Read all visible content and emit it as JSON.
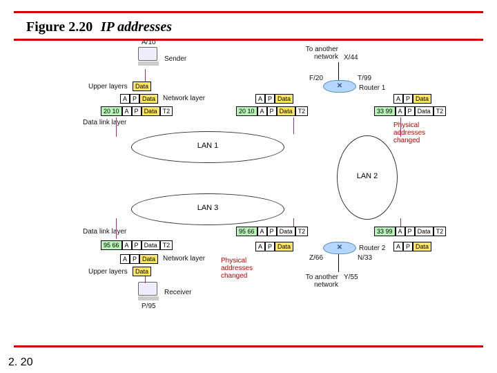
{
  "title": {
    "figure": "Figure 2.20",
    "subtitle": "IP addresses"
  },
  "footer": "2. 20",
  "nodes": {
    "sender_pc": "A/10",
    "receiver_pc": "P/95",
    "router1_left": "F/20",
    "router1_right": "T/99",
    "router2_left": "Z/66",
    "router2_right": "N/33",
    "external_top": "X/44",
    "external_bottom": "Y/55"
  },
  "labels": {
    "sender": "Sender",
    "receiver": "Receiver",
    "upper": "Upper layers",
    "network": "Network layer",
    "datalink": "Data link layer",
    "to_another": "To another\nnetwork",
    "changed": "Physical\naddresses\nchanged",
    "lan1": "LAN 1",
    "lan2": "LAN 2",
    "lan3": "LAN 3",
    "router1": "Router 1",
    "router2": "Router 2"
  },
  "pk": {
    "data": "Data",
    "A": "A",
    "P": "P",
    "mac_sender": "20 10",
    "T2": "T2",
    "mac_r2left": "33 99",
    "mac_rcv": "95 66"
  }
}
